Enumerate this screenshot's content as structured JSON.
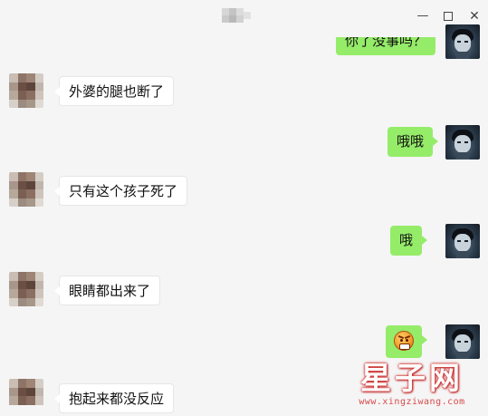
{
  "window": {
    "minimize_glyph": "—",
    "close_glyph": "✕"
  },
  "messages": [
    {
      "side": "right",
      "text": "你了没事吗？",
      "partial": true
    },
    {
      "side": "left",
      "text": "外婆的腿也断了"
    },
    {
      "side": "right",
      "text": "哦哦"
    },
    {
      "side": "left",
      "text": "只有这个孩子死了"
    },
    {
      "side": "right",
      "text": "哦"
    },
    {
      "side": "left",
      "text": "眼睛都出来了"
    },
    {
      "side": "right",
      "text": "",
      "emoji": "angry-face-emoji"
    },
    {
      "side": "left",
      "text": "抱起来都没反应"
    }
  ],
  "watermark": {
    "title": "星子网",
    "url": "www.xingziwang.com"
  },
  "colors": {
    "background": "#f5f5f5",
    "my_bubble": "#95ec69",
    "their_bubble": "#ffffff",
    "watermark_red": "#d23030"
  }
}
